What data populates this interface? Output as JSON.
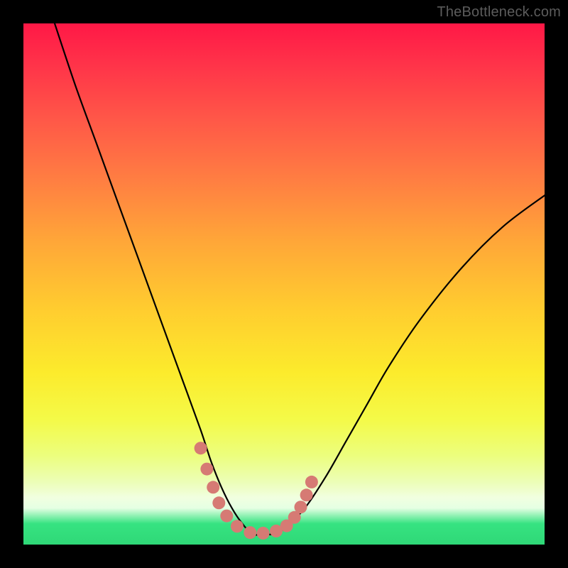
{
  "watermark": "TheBottleneck.com",
  "chart_data": {
    "type": "line",
    "title": "",
    "xlabel": "",
    "ylabel": "",
    "xlim": [
      0,
      100
    ],
    "ylim": [
      0,
      100
    ],
    "series": [
      {
        "name": "curve",
        "x": [
          6,
          10,
          14,
          18,
          22,
          26,
          30,
          34,
          36,
          38,
          40,
          42,
          44,
          46,
          48,
          50,
          54,
          58,
          62,
          66,
          70,
          76,
          84,
          92,
          100
        ],
        "y": [
          100,
          88,
          77,
          66,
          55,
          44,
          33,
          22,
          16,
          11,
          7,
          4,
          2,
          2,
          2,
          3,
          7,
          13,
          20,
          27,
          34,
          43,
          53,
          61,
          67
        ]
      }
    ],
    "markers": {
      "name": "highlight-dots",
      "color": "#d67a74",
      "points": [
        {
          "x": 34.0,
          "y": 18.5
        },
        {
          "x": 35.2,
          "y": 14.5
        },
        {
          "x": 36.4,
          "y": 11.0
        },
        {
          "x": 37.5,
          "y": 8.0
        },
        {
          "x": 39.0,
          "y": 5.5
        },
        {
          "x": 41.0,
          "y": 3.5
        },
        {
          "x": 43.5,
          "y": 2.3
        },
        {
          "x": 46.0,
          "y": 2.2
        },
        {
          "x": 48.5,
          "y": 2.6
        },
        {
          "x": 50.5,
          "y": 3.6
        },
        {
          "x": 52.0,
          "y": 5.2
        },
        {
          "x": 53.2,
          "y": 7.2
        },
        {
          "x": 54.3,
          "y": 9.5
        },
        {
          "x": 55.3,
          "y": 12.0
        }
      ]
    }
  }
}
